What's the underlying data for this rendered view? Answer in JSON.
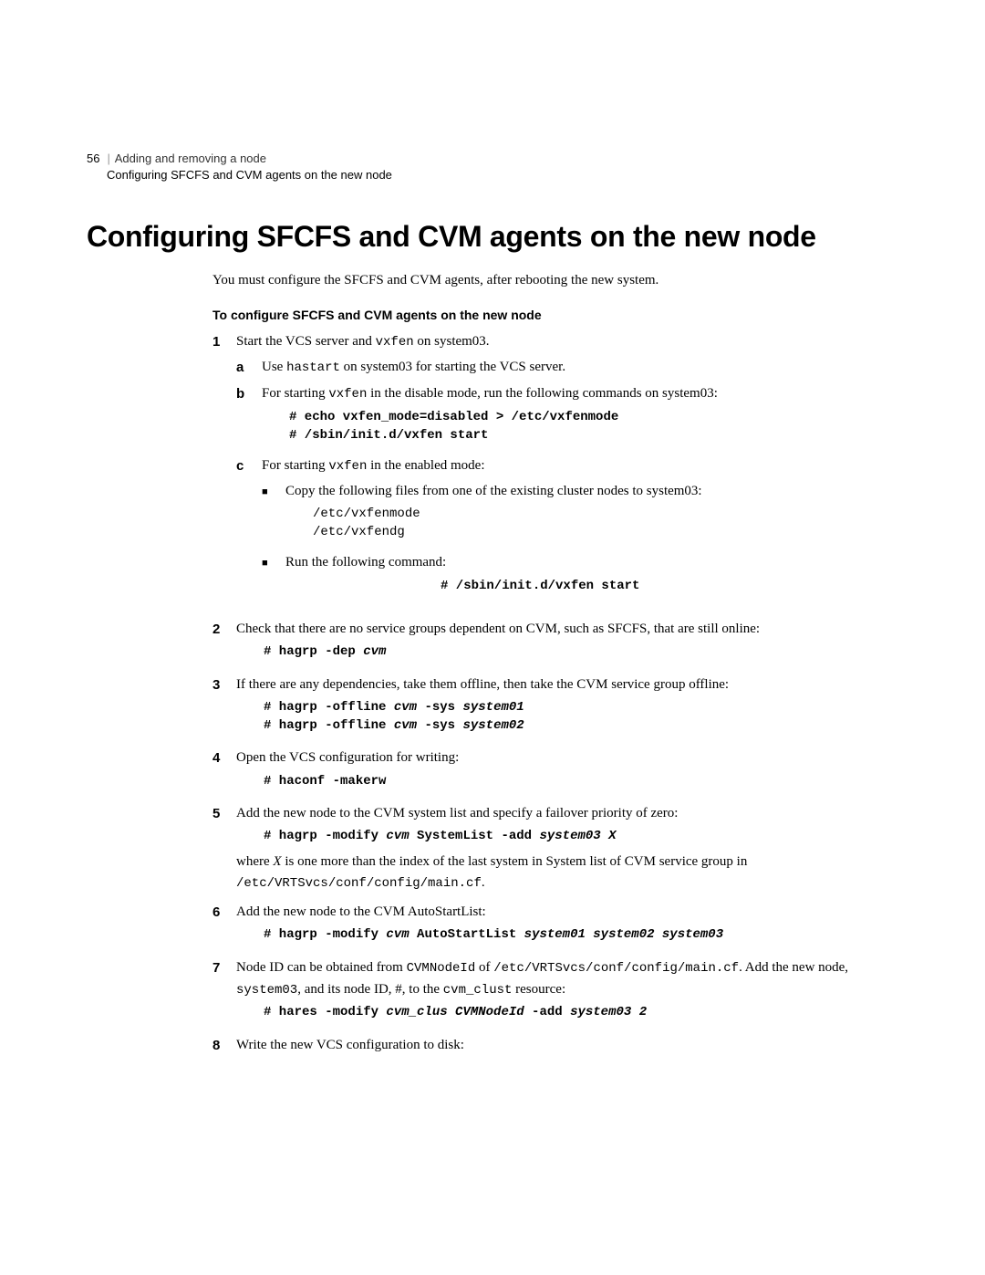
{
  "page_number": "56",
  "breadcrumb": {
    "top": "Adding and removing a node",
    "sub": "Configuring SFCFS and CVM agents on the new node"
  },
  "title": "Configuring SFCFS and CVM agents on the new node",
  "intro": "You must configure the SFCFS and CVM agents, after rebooting the new system.",
  "subheading": "To configure SFCFS and CVM agents on the new node",
  "step1": {
    "text_a": "Start the VCS server and ",
    "code_a": "vxfen",
    "text_b": " on system03.",
    "a": {
      "t1": "Use ",
      "c1": "hastart",
      "t2": " on system03 for starting the VCS server."
    },
    "b": {
      "t1": "For starting ",
      "c1": "vxfen",
      "t2": " in the disable mode, run the following commands on system03:",
      "cmd": "# echo vxfen_mode=disabled > /etc/vxfenmode\n# /sbin/init.d/vxfen start"
    },
    "c": {
      "t1": "For starting ",
      "c1": "vxfen",
      "t2": " in the enabled mode:",
      "bullet1": "Copy the following files from one of the existing cluster nodes to system03:",
      "files": "/etc/vxfenmode\n/etc/vxfendg",
      "bullet2": "Run the following command:",
      "cmd": "# /sbin/init.d/vxfen start"
    }
  },
  "step2": {
    "text": "Check that there are no service groups dependent on CVM, such as SFCFS, that are still online:",
    "cmd_prefix": "# hagrp -dep ",
    "cmd_arg": "cvm"
  },
  "step3": {
    "text": "If there are any dependencies, take them offline, then take the CVM service group offline:",
    "cmd1_a": "# hagrp -offline ",
    "cmd1_b": "cvm",
    "cmd1_c": " -sys ",
    "cmd1_d": "system01",
    "cmd2_a": "# hagrp -offline ",
    "cmd2_b": "cvm",
    "cmd2_c": " -sys ",
    "cmd2_d": "system02"
  },
  "step4": {
    "text": "Open the VCS configuration for writing:",
    "cmd": "# haconf -makerw"
  },
  "step5": {
    "text": "Add the new node to the CVM system list and specify a failover priority of zero:",
    "cmd_a": "# hagrp -modify ",
    "cmd_b": "cvm",
    "cmd_c": " SystemList -add ",
    "cmd_d": "system03 X",
    "after_a": "where ",
    "after_x": "X",
    "after_b": " is one more than the index of the last system in System list of CVM service group in ",
    "after_path": "/etc/VRTSvcs/conf/config/main.cf",
    "after_c": "."
  },
  "step6": {
    "text": "Add the new node to the CVM AutoStartList:",
    "cmd_a": "# hagrp -modify ",
    "cmd_b": "cvm",
    "cmd_c": " AutoStartList ",
    "cmd_d": "system01 system02 system03"
  },
  "step7": {
    "t1": "Node ID can be obtained from ",
    "c1": "CVMNodeId",
    "t2": " of ",
    "c2": "/etc/VRTSvcs/conf/config/main.cf",
    "t3": ". Add the new node, ",
    "c3": "system03",
    "t4": ", and its node ID, #, to the ",
    "c4": "cvm_clust",
    "t5": " resource:",
    "cmd_a": "# hares -modify ",
    "cmd_b": "cvm_clus CVMNodeId",
    "cmd_c": " -add ",
    "cmd_d": "system03 2"
  },
  "step8": {
    "text": "Write the new VCS configuration to disk:"
  }
}
